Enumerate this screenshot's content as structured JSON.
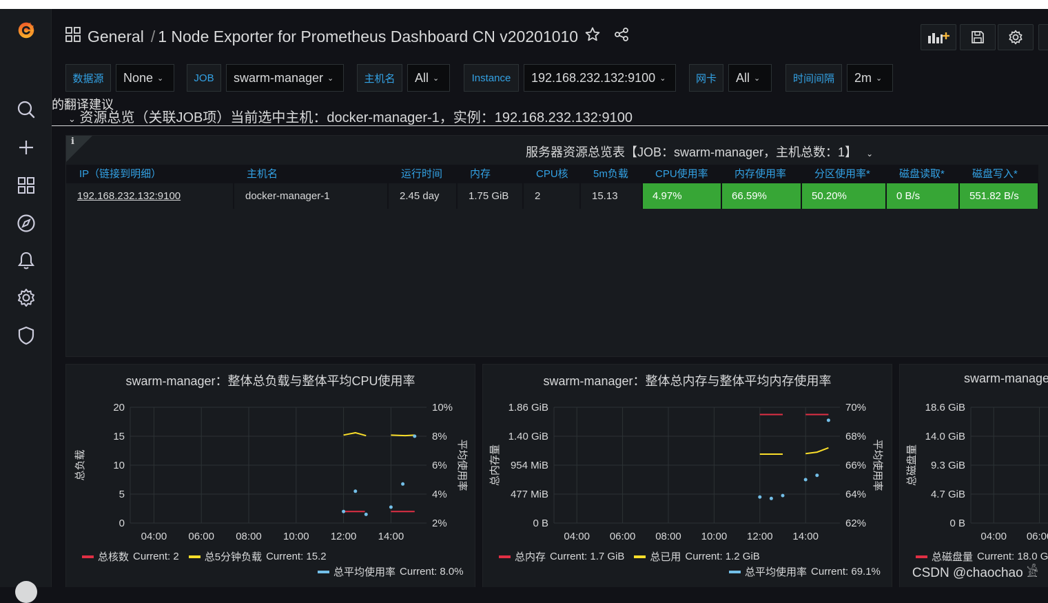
{
  "header": {
    "folder": "General",
    "separator": "/",
    "title": "1 Node Exporter for Prometheus Dashboard CN v20201010"
  },
  "variables": [
    {
      "label": "数据源",
      "value": "None"
    },
    {
      "label": "JOB",
      "value": "swarm-manager"
    },
    {
      "label": "主机名",
      "value": "All"
    },
    {
      "label": "Instance",
      "value": "192.168.232.132:9100"
    },
    {
      "label": "网卡",
      "value": "All"
    },
    {
      "label": "时间间隔",
      "value": "2m"
    }
  ],
  "translate_overlay": "的翻译建议",
  "row_title": "资源总览（关联JOB项）当前选中主机：docker-manager-1，实例：192.168.232.132:9100",
  "table_panel": {
    "info": "i",
    "title": "服务器资源总览表【JOB：swarm-manager，主机总数：1】",
    "columns": [
      "IP（链接到明细）",
      "主机名",
      "运行时间",
      "内存",
      "CPU核",
      "5m负载",
      "CPU使用率",
      "内存使用率",
      "分区使用率*",
      "磁盘读取*",
      "磁盘写入*"
    ],
    "rows": [
      [
        "192.168.232.132:9100",
        "docker-manager-1",
        "2.45 day",
        "1.75 GiB",
        "2",
        "15.13",
        "4.97%",
        "66.59%",
        "50.20%",
        "0 B/s",
        "551.82 B/s"
      ]
    ]
  },
  "colors": {
    "green": "#37a636",
    "red": "#e02f44",
    "yellow": "#fade2a",
    "cyan": "#73bfe8",
    "blue": "#33a2e5"
  },
  "chart_data": [
    {
      "type": "line",
      "title": "swarm-manager：整体总负载与整体平均CPU使用率",
      "ylabel": "总负载",
      "y2label": "平均使用率",
      "x_ticks": [
        "04:00",
        "06:00",
        "08:00",
        "10:00",
        "12:00",
        "14:00"
      ],
      "y_ticks": [
        "0",
        "5",
        "10",
        "15",
        "20"
      ],
      "y2_ticks": [
        "2%",
        "4%",
        "6%",
        "8%",
        "10%"
      ],
      "ylim": [
        0,
        20
      ],
      "y2lim": [
        2,
        10
      ],
      "series": [
        {
          "name": "总核数",
          "axis": "left",
          "color": "#e02f44",
          "current": "Current: 2",
          "x": [
            12.0,
            12.9
          ],
          "values": [
            2,
            2
          ],
          "x2": [
            14.0,
            15.0
          ],
          "values2": [
            2,
            2
          ]
        },
        {
          "name": "总5分钟负载",
          "axis": "left",
          "color": "#fade2a",
          "current": "Current: 15.2",
          "x": [
            12.0,
            12.5,
            12.95
          ],
          "values": [
            15.2,
            15.6,
            15.1
          ],
          "x2": [
            14.0,
            14.6,
            15.0
          ],
          "values2": [
            15.2,
            15.1,
            15.2
          ]
        },
        {
          "name": "总平均使用率",
          "axis": "right",
          "color": "#73bfe8",
          "current": "Current: 8.0%",
          "points_x": [
            12.0,
            12.5,
            12.95,
            14.0,
            14.5,
            15.0
          ],
          "points_y": [
            2.8,
            4.2,
            2.6,
            3.1,
            4.7,
            8.0
          ]
        }
      ]
    },
    {
      "type": "line",
      "title": "swarm-manager：整体总内存与整体平均内存使用率",
      "ylabel": "总内存量",
      "y2label": "平均使用率",
      "x_ticks": [
        "04:00",
        "06:00",
        "08:00",
        "10:00",
        "12:00",
        "14:00"
      ],
      "y_ticks": [
        "0 B",
        "477 MiB",
        "954 MiB",
        "1.40 GiB",
        "1.86 GiB"
      ],
      "y2_ticks": [
        "62%",
        "64%",
        "66%",
        "68%",
        "70%"
      ],
      "ylim": [
        0,
        4
      ],
      "y2lim": [
        62,
        70
      ],
      "series": [
        {
          "name": "总内存",
          "axis": "left",
          "color": "#e02f44",
          "current": "Current: 1.7 GiB",
          "x": [
            12.0,
            13.0
          ],
          "values": [
            3.75,
            3.75
          ],
          "x2": [
            14.0,
            15.0
          ],
          "values2": [
            3.75,
            3.75
          ]
        },
        {
          "name": "总已用",
          "axis": "left",
          "color": "#fade2a",
          "current": "Current: 1.2 GiB",
          "x": [
            12.0,
            13.0
          ],
          "values": [
            2.38,
            2.38
          ],
          "x2": [
            14.0,
            14.5,
            15.0
          ],
          "values2": [
            2.4,
            2.45,
            2.6
          ]
        },
        {
          "name": "总平均使用率",
          "axis": "right",
          "color": "#73bfe8",
          "current": "Current: 69.1%",
          "points_x": [
            12.0,
            12.5,
            13.0,
            14.0,
            14.5,
            15.0
          ],
          "points_y": [
            63.8,
            63.7,
            63.9,
            65.0,
            65.3,
            69.1
          ]
        }
      ]
    },
    {
      "type": "line",
      "title": "swarm-manage",
      "ylabel": "总磁盘量",
      "x_ticks": [
        "04:00",
        "06:00"
      ],
      "y_ticks": [
        "0 B",
        "4.7 GiB",
        "9.3 GiB",
        "14.0 GiB",
        "18.6 GiB"
      ],
      "series": [
        {
          "name": "总磁盘量",
          "color": "#e02f44",
          "current": "Current: 18.0 G"
        }
      ]
    }
  ],
  "watermark": "CSDN @chaochao 𓀀"
}
